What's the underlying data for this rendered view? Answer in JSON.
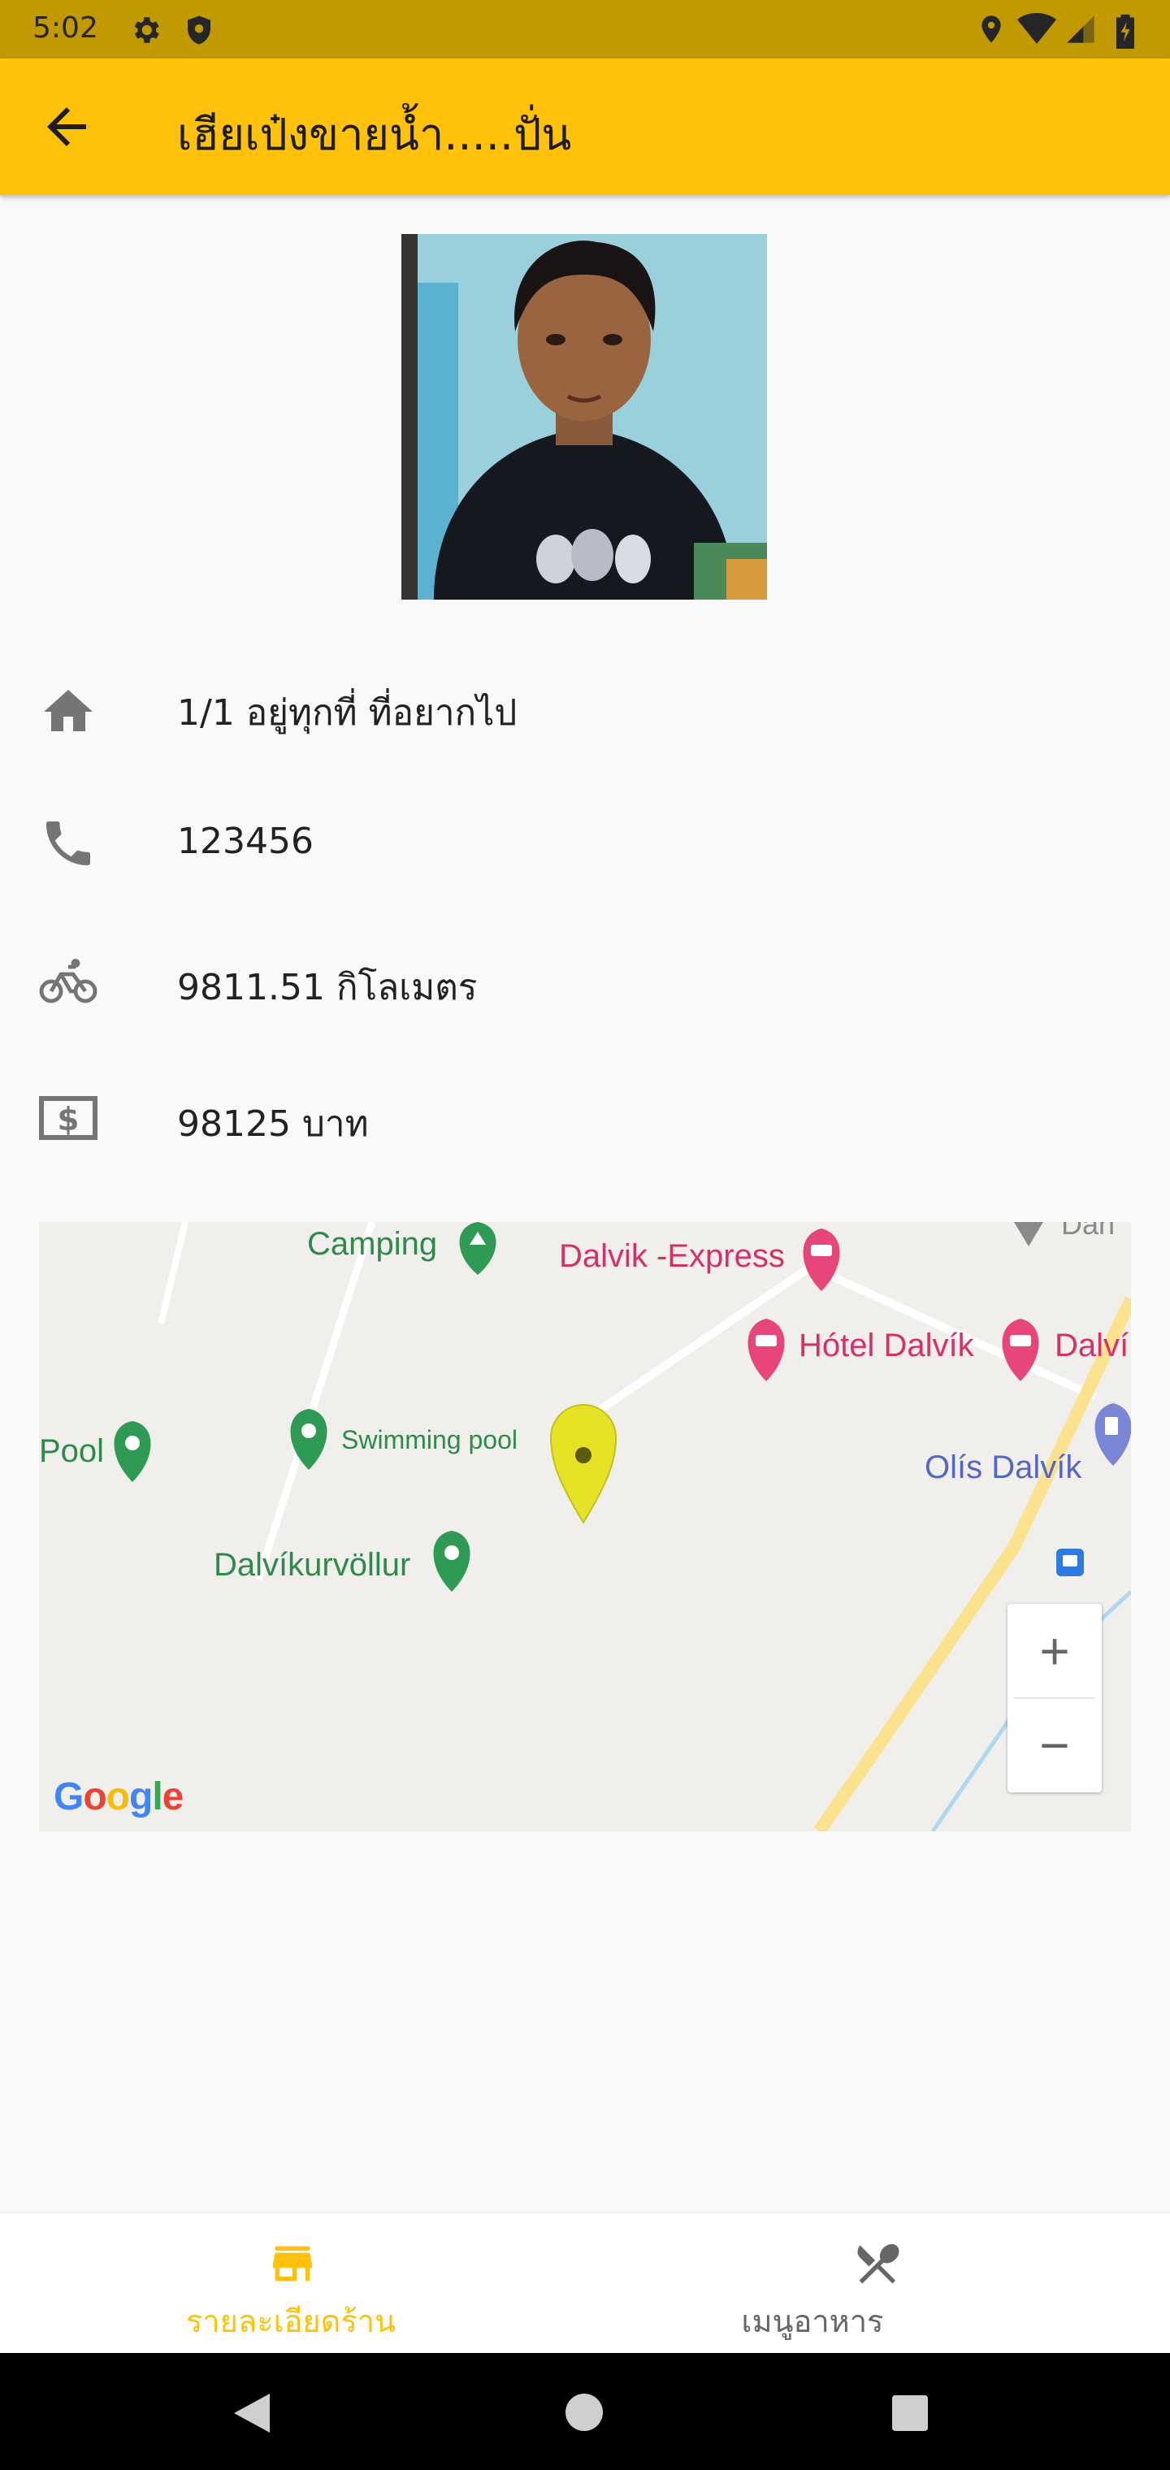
{
  "status_bar": {
    "time": "5:02",
    "icons": [
      "gear-icon",
      "shield-icon",
      "location-icon",
      "wifi-icon",
      "signal-icon",
      "battery-icon"
    ]
  },
  "app_bar": {
    "title": "เฮียเป๋งขายน้ำ.....ปั่น",
    "back_icon": "arrow-back-icon",
    "color": "#ffc10a"
  },
  "shop": {
    "address": "1/1 อยู่ทุกที่ ที่อยากไป",
    "phone": "123456",
    "distance": "9811.51  กิโลเมตร",
    "price": "98125 บาท"
  },
  "map": {
    "labels": {
      "camping": "Camping",
      "dalvik_express": "Dalvik -Express",
      "hotel_dalvik": "Hótel Dalvík",
      "dalvik_cut": "Dalví",
      "pool": "Pool",
      "swimming_pool": "Swimming pool",
      "olis_dalvik": "Olís Dalvík",
      "dalvikurvollur": "Dalvíkurvöllur",
      "top_right_cut": "Dan"
    },
    "attribution": "Google",
    "zoom_in": "+",
    "zoom_out": "−"
  },
  "bottom_nav": {
    "items": [
      {
        "label": "รายละเอียดร้าน",
        "icon": "store-icon",
        "active": true
      },
      {
        "label": "เมนูอาหาร",
        "icon": "restaurant-icon",
        "active": false
      }
    ],
    "active_color": "#ffc10a",
    "inactive_color": "#666666"
  },
  "system_nav": {
    "icons": [
      "back-triangle-icon",
      "home-circle-icon",
      "recents-square-icon"
    ]
  }
}
